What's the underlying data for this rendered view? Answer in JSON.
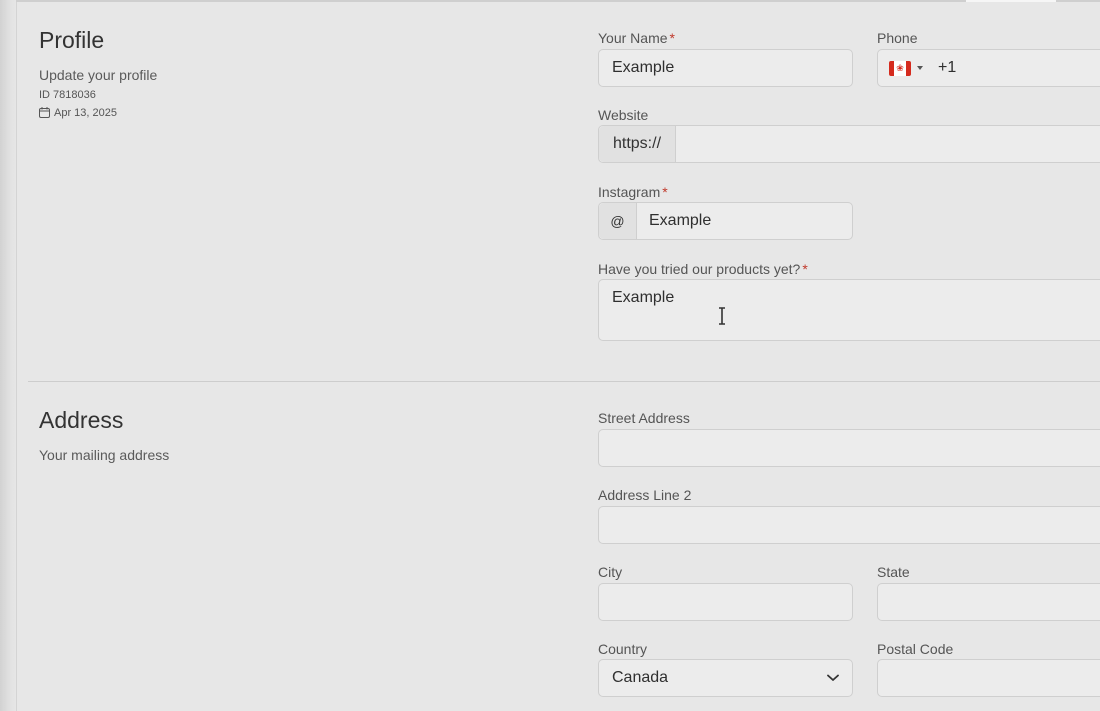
{
  "profile": {
    "title": "Profile",
    "subtitle": "Update your profile",
    "id_text": "ID 7818036",
    "date_text": "Apr 13, 2025",
    "name": {
      "label": "Your Name",
      "required": "*",
      "value": "Example"
    },
    "phone": {
      "label": "Phone",
      "country_flag": "canada-flag-icon",
      "dial_code": "+1",
      "value": ""
    },
    "website": {
      "label": "Website",
      "prefix": "https://",
      "value": ""
    },
    "instagram": {
      "label": "Instagram",
      "required": "*",
      "prefix": "@",
      "value": "Example"
    },
    "products": {
      "label": "Have you tried our products yet?",
      "required": "*",
      "value": "Example"
    }
  },
  "address": {
    "title": "Address",
    "subtitle": "Your mailing address",
    "street": {
      "label": "Street Address",
      "value": ""
    },
    "line2": {
      "label": "Address Line 2",
      "value": ""
    },
    "city": {
      "label": "City",
      "value": ""
    },
    "state": {
      "label": "State",
      "value": ""
    },
    "country": {
      "label": "Country",
      "selected": "Canada"
    },
    "postal": {
      "label": "Postal Code",
      "value": ""
    }
  },
  "colors": {
    "background": "#e7e7e7",
    "field_bg": "#ececec",
    "border": "#cfcfcf",
    "required": "#c0392b"
  }
}
